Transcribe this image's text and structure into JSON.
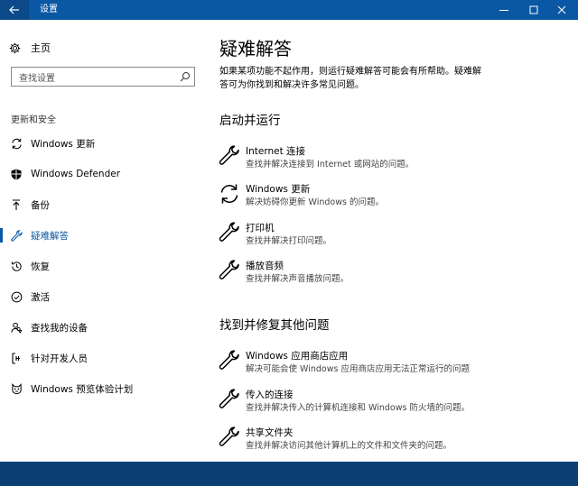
{
  "window": {
    "title": "设置",
    "back_icon": "back-arrow-icon",
    "controls": [
      "minimize-icon",
      "maximize-icon",
      "close-icon"
    ]
  },
  "sidebar": {
    "home_label": "主页",
    "search_placeholder": "查找设置",
    "section_label": "更新和安全",
    "items": [
      {
        "label": "Windows 更新",
        "icon": "refresh-icon",
        "selected": false
      },
      {
        "label": "Windows Defender",
        "icon": "shield-icon",
        "selected": false
      },
      {
        "label": "备份",
        "icon": "backup-arrow-icon",
        "selected": false
      },
      {
        "label": "疑难解答",
        "icon": "wrench-icon",
        "selected": true
      },
      {
        "label": "恢复",
        "icon": "history-icon",
        "selected": false
      },
      {
        "label": "激活",
        "icon": "check-circle-icon",
        "selected": false
      },
      {
        "label": "查找我的设备",
        "icon": "person-pin-icon",
        "selected": false
      },
      {
        "label": "针对开发人员",
        "icon": "developer-icon",
        "selected": false
      },
      {
        "label": "Windows 预览体验计划",
        "icon": "insider-cat-icon",
        "selected": false
      }
    ]
  },
  "main": {
    "title": "疑难解答",
    "intro_line1": "如果某项功能不起作用，则运行疑难解答可能会有所帮助。疑难解",
    "intro_line2": "答可为你找到和解决许多常见问题。",
    "section1": {
      "heading": "启动并运行",
      "items": [
        {
          "name": "Internet 连接",
          "desc": "查找并解决连接到 Internet 或网站的问题。",
          "icon": "wrench-icon"
        },
        {
          "name": "Windows 更新",
          "desc": "解决妨碍你更新 Windows 的问题。",
          "icon": "refresh-icon"
        },
        {
          "name": "打印机",
          "desc": "查找并解决打印问题。",
          "icon": "wrench-icon"
        },
        {
          "name": "播放音频",
          "desc": "查找并解决声音播放问题。",
          "icon": "wrench-icon"
        }
      ]
    },
    "section2": {
      "heading": "找到并修复其他问题",
      "items": [
        {
          "name": "Windows 应用商店应用",
          "desc": "解决可能会使 Windows 应用商店应用无法正常运行的问题",
          "icon": "wrench-icon"
        },
        {
          "name": "传入的连接",
          "desc": "查找并解决传入的计算机连接和 Windows 防火墙的问题。",
          "icon": "wrench-icon"
        },
        {
          "name": "共享文件夹",
          "desc": "查找并解决访问其他计算机上的文件和文件夹的问题。",
          "icon": "wrench-icon"
        }
      ]
    }
  },
  "colors": {
    "accent": "#0a57a4",
    "taskbar": "#0c3f74"
  }
}
